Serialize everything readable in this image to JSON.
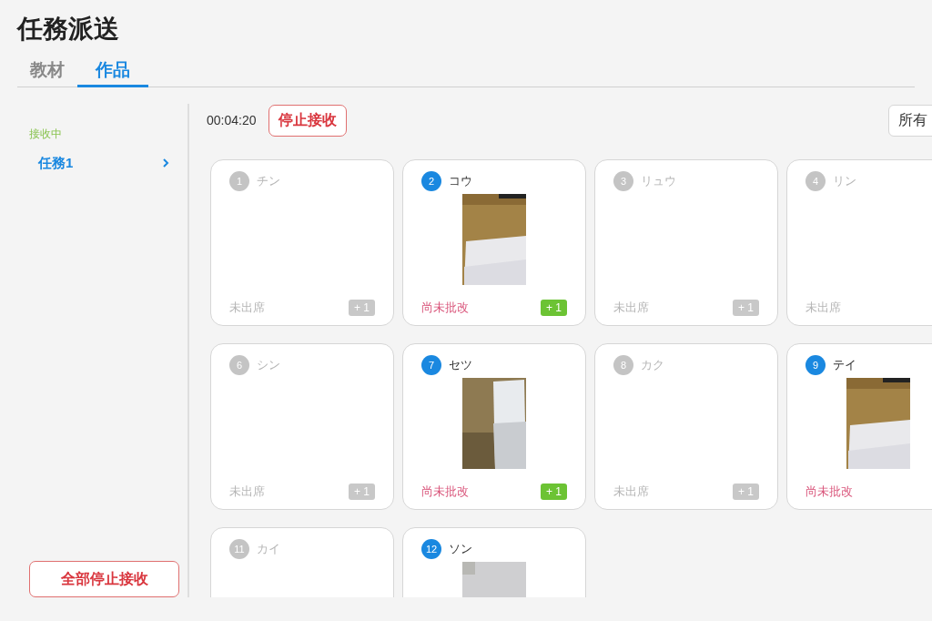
{
  "title": "任務派送",
  "tabs": [
    {
      "label": "教材",
      "selected": false
    },
    {
      "label": "作品",
      "selected": true
    }
  ],
  "sidebar": {
    "group_label": "接收中",
    "items": [
      {
        "label": "任務1",
        "selected": true
      }
    ],
    "stop_all_button": "全部停止接收"
  },
  "toolbar": {
    "timer": "00:04:20",
    "stop_button": "停止接收",
    "filter": "所有"
  },
  "cards": [
    {
      "number": "1",
      "name": "チン",
      "submitted": false,
      "status": "未出席",
      "badge": "+ 1"
    },
    {
      "number": "2",
      "name": "コウ",
      "submitted": true,
      "status": "尚未批改",
      "badge": "+ 1"
    },
    {
      "number": "3",
      "name": "リュウ",
      "submitted": false,
      "status": "未出席",
      "badge": "+ 1"
    },
    {
      "number": "4",
      "name": "リン",
      "submitted": false,
      "status": "未出席"
    },
    {
      "number": "6",
      "name": "シン",
      "submitted": false,
      "status": "未出席",
      "badge": "+ 1"
    },
    {
      "number": "7",
      "name": "セツ",
      "submitted": true,
      "status": "尚未批改",
      "badge": "+ 1"
    },
    {
      "number": "8",
      "name": "カク",
      "submitted": false,
      "status": "未出席",
      "badge": "+ 1"
    },
    {
      "number": "9",
      "name": "テイ",
      "submitted": true,
      "status": "尚未批改"
    },
    {
      "number": "11",
      "name": "カイ",
      "submitted": false
    },
    {
      "number": "12",
      "name": "ソン",
      "submitted": true
    }
  ]
}
